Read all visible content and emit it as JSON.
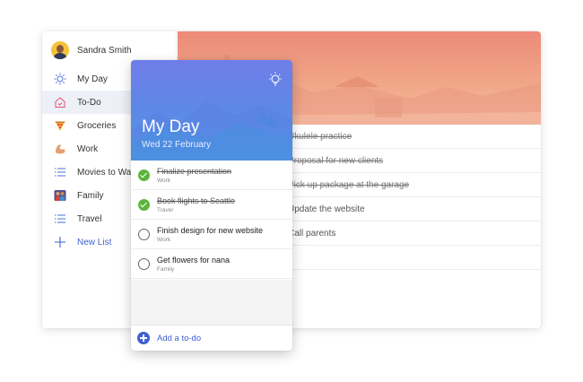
{
  "user": {
    "name": "Sandra Smith"
  },
  "sidebar": {
    "items": [
      {
        "label": "My Day",
        "icon": "sun-icon",
        "active": false
      },
      {
        "label": "To-Do",
        "icon": "house-icon",
        "active": true
      },
      {
        "label": "Groceries",
        "icon": "pizza-icon",
        "active": false
      },
      {
        "label": "Work",
        "icon": "flexed-arm-icon",
        "active": false
      },
      {
        "label": "Movies to Watch",
        "icon": "list-icon",
        "active": false
      },
      {
        "label": "Family",
        "icon": "family-icon",
        "active": false
      },
      {
        "label": "Travel",
        "icon": "list-icon",
        "active": false
      }
    ],
    "new_list_label": "New List"
  },
  "back_tasks": [
    {
      "text": "Ukulele practice",
      "done": true
    },
    {
      "text": "Proposal for new clients",
      "done": true
    },
    {
      "text": "Pick up package at the garage",
      "done": true
    },
    {
      "text": "Update the website",
      "done": false
    },
    {
      "text": "Call parents",
      "done": false
    },
    {
      "text": "",
      "done": false
    }
  ],
  "my_day": {
    "title": "My Day",
    "date": "Wed 22 February",
    "tasks": [
      {
        "title": "Finalize presentation",
        "list": "Work",
        "done": true
      },
      {
        "title": "Book flights to Seattle",
        "list": "Travel",
        "done": true
      },
      {
        "title": "Finish design for new website",
        "list": "Work",
        "done": false
      },
      {
        "title": "Get flowers for nana",
        "list": "Family",
        "done": false
      }
    ],
    "add_label": "Add a to-do"
  },
  "colors": {
    "accent": "#3f5fd6",
    "done_check": "#5cb53b",
    "header_top": "#6f7de8",
    "header_bottom": "#4aa3e6",
    "banner": "#ec8a78"
  }
}
